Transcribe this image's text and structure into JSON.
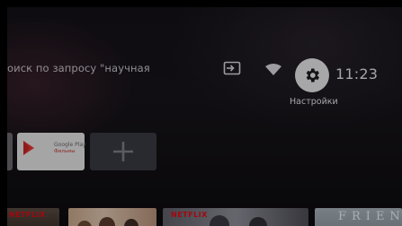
{
  "search": {
    "query_text": "оиск по запросу \"научная"
  },
  "status_bar": {
    "time": "11:23",
    "settings_label": "Настройки"
  },
  "apps": {
    "google_play_title": "Google Play",
    "google_play_subtitle": "Фильмы"
  },
  "content_row": {
    "cards": [
      {
        "badge": "NETFLIX"
      },
      {
        "badge": ""
      },
      {
        "badge": "NETFLIX"
      },
      {
        "title": "FRIENDS"
      }
    ]
  },
  "colors": {
    "background": "#141117",
    "settings_button": "#e8e8ea",
    "netflix_red": "#e50914",
    "add_tile": "#3a3b42"
  },
  "icons": {
    "input": "input-source-icon",
    "wifi": "wifi-icon",
    "settings": "gear-icon",
    "add": "plus-icon"
  }
}
